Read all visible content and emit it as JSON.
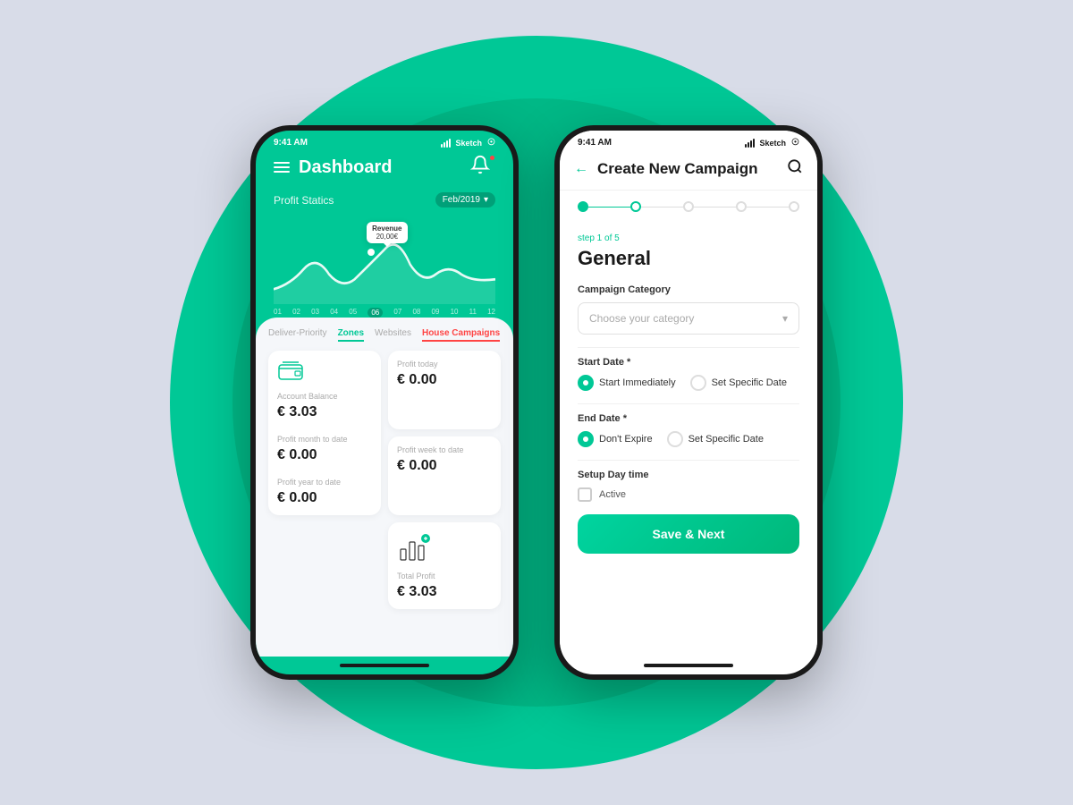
{
  "background": {
    "circle_color": "#00c896",
    "inner_circle_color": "#00b080"
  },
  "phone1": {
    "status_bar": {
      "time": "9:41 AM",
      "carrier": "Sketch",
      "wifi": true
    },
    "header": {
      "title": "Dashboard",
      "notification_badge": true
    },
    "chart": {
      "title": "Profit Statics",
      "date_filter": "Feb/2019",
      "tooltip_label": "Revenue",
      "tooltip_value": "20,00€",
      "x_labels": [
        "01",
        "02",
        "03",
        "04",
        "05",
        "06",
        "07",
        "08",
        "09",
        "10",
        "11",
        "12"
      ],
      "active_label": "06"
    },
    "tabs": [
      {
        "label": "Deliver-Priority",
        "active": false,
        "color": "default"
      },
      {
        "label": "Zones",
        "active": true,
        "color": "green"
      },
      {
        "label": "Websites",
        "active": false,
        "color": "default"
      },
      {
        "label": "House Campaigns",
        "active": true,
        "color": "red"
      }
    ],
    "stats": [
      {
        "label": "Account Balance",
        "value": "€ 3.03",
        "icon": "wallet"
      },
      {
        "label": "Profit today",
        "value": "€ 0.00"
      },
      {
        "label": "Profit week to date",
        "value": "€ 0.00"
      },
      {
        "label": "Profit month to date",
        "value": "€ 0.00"
      },
      {
        "label": "Total Profit",
        "value": "€ 3.03",
        "icon": "chart"
      },
      {
        "label": "Profit year to date",
        "value": "€ 0.00"
      }
    ]
  },
  "phone2": {
    "status_bar": {
      "time": "9:41 AM",
      "carrier": "Sketch",
      "wifi": true
    },
    "header": {
      "title": "Create New Campaign",
      "back_label": "←",
      "search_icon": "🔍"
    },
    "progress": {
      "current_step": 1,
      "total_steps": 5,
      "step_label": "step 1 of 5"
    },
    "form": {
      "section_title": "General",
      "campaign_category_label": "Campaign Category",
      "category_placeholder": "Choose your category",
      "start_date_label": "Start Date *",
      "start_options": [
        {
          "label": "Start Immediately",
          "checked": true
        },
        {
          "label": "Set Specific Date",
          "checked": false
        }
      ],
      "end_date_label": "End Date *",
      "end_options": [
        {
          "label": "Don't Expire",
          "checked": true
        },
        {
          "label": "Set Specific Date",
          "checked": false
        }
      ],
      "setup_day_time_label": "Setup Day time",
      "active_checkbox_label": "Active",
      "save_button_label": "Save & Next"
    }
  }
}
